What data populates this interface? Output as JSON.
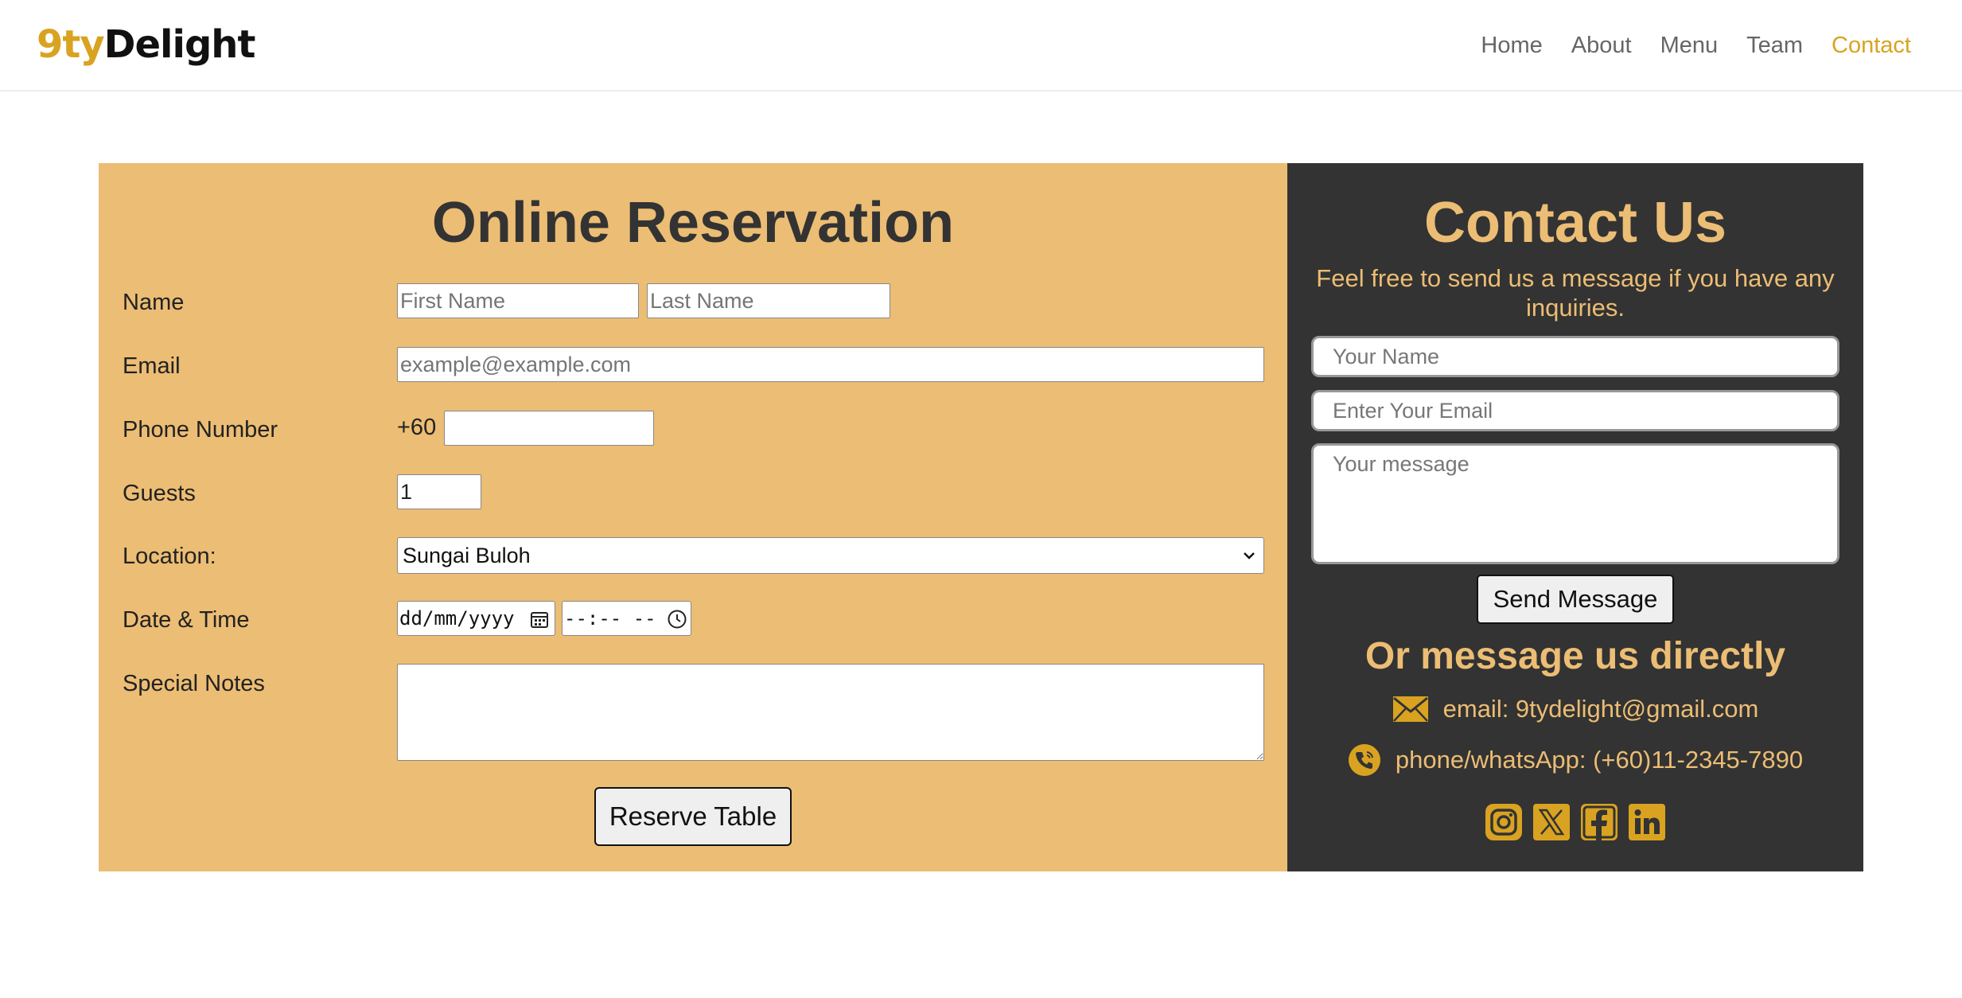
{
  "brand": {
    "logo_prefix": "9ty",
    "logo_suffix": "Delight",
    "accent_color": "#d9a321"
  },
  "nav": {
    "items": [
      "Home",
      "About",
      "Menu",
      "Team",
      "Contact"
    ],
    "active": "Contact"
  },
  "reservation": {
    "title": "Online Reservation",
    "background": "#ecbd74",
    "labels": {
      "name": "Name",
      "email": "Email",
      "phone": "Phone Number",
      "guests": "Guests",
      "location": "Location:",
      "datetime": "Date & Time",
      "notes": "Special Notes"
    },
    "placeholders": {
      "first_name": "First Name",
      "last_name": "Last Name",
      "email": "example@example.com"
    },
    "phone_prefix": "+60",
    "guests_value": "1",
    "location_selected": "Sungai Buloh",
    "date_placeholder": "dd/mm/yyyy",
    "time_placeholder": "--:-- --",
    "submit_label": "Reserve Table"
  },
  "contact": {
    "title": "Contact Us",
    "subtitle": "Feel free to send us a message if you have any inquiries.",
    "background": "#333333",
    "placeholders": {
      "name": "Your Name",
      "email": "Enter Your Email",
      "message": "Your message"
    },
    "send_label": "Send Message",
    "direct_heading": "Or message us directly",
    "email_text": "email: 9tydelight@gmail.com",
    "phone_text": "phone/whatsApp: (+60)11-2345-7890",
    "socials": [
      "instagram-icon",
      "x-icon",
      "facebook-icon",
      "linkedin-icon"
    ]
  }
}
